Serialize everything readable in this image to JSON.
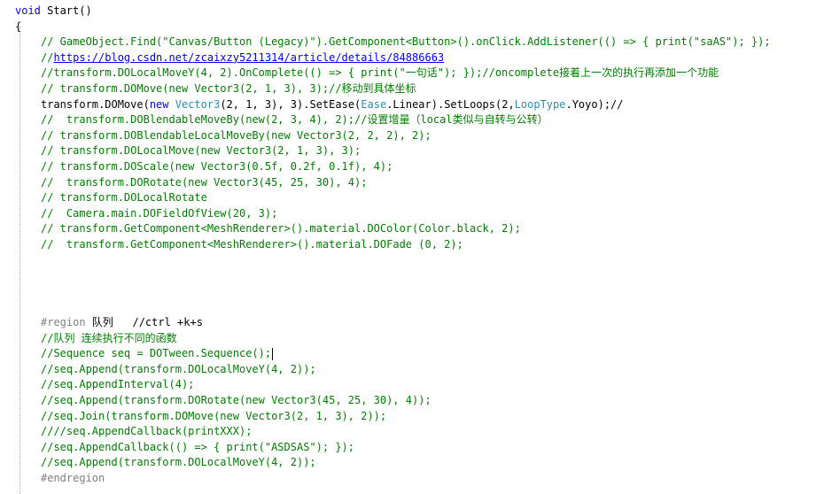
{
  "editor": {
    "lines": [
      {
        "text": "void Start()",
        "kind": "plain",
        "indent": 0
      },
      {
        "text": "{",
        "kind": "plain",
        "indent": 0
      },
      {
        "text": "// GameObject.Find(\"Canvas/Button (Legacy)\").GetComponent<Button>().onClick.AddListener(() => { print(\"saAS\"); });",
        "kind": "comment",
        "indent": 1
      },
      {
        "text": "//https://blog.csdn.net/zcaixzy5211314/article/details/84886663",
        "kind": "comment-link",
        "indent": 1
      },
      {
        "text": "//transform.DOLocalMoveY(4, 2).OnComplete(() => { print(\"一句话\"); });//oncomplete接着上一次的执行再添加一个功能",
        "kind": "comment",
        "indent": 1
      },
      {
        "text": "// transform.DOMove(new Vector3(2, 1, 3), 3);//移动到具体坐标",
        "kind": "comment",
        "indent": 1
      },
      {
        "text": "transform.DOMove(new Vector3(2, 1, 3), 3).SetEase(Ease.Linear).SetLoops(2,LoopType.Yoyo);//",
        "kind": "code",
        "indent": 1
      },
      {
        "text": "//  transform.DOBlendableMoveBy(new(2, 3, 4), 2);//设置增量（local类似与自转与公转）",
        "kind": "comment",
        "indent": 1
      },
      {
        "text": "// transform.DOBlendableLocalMoveBy(new Vector3(2, 2, 2), 2);",
        "kind": "comment",
        "indent": 1
      },
      {
        "text": "// transform.DOLocalMove(new Vector3(2, 1, 3), 3);",
        "kind": "comment",
        "indent": 1
      },
      {
        "text": "// transform.DOScale(new Vector3(0.5f, 0.2f, 0.1f), 4);",
        "kind": "comment",
        "indent": 1
      },
      {
        "text": "//  transform.DORotate(new Vector3(45, 25, 30), 4);",
        "kind": "comment",
        "indent": 1
      },
      {
        "text": "// transform.DOLocalRotate",
        "kind": "comment",
        "indent": 1
      },
      {
        "text": "//  Camera.main.DOFieldOfView(20, 3);",
        "kind": "comment",
        "indent": 1
      },
      {
        "text": "// transform.GetComponent<MeshRenderer>().material.DOColor(Color.black, 2);",
        "kind": "comment",
        "indent": 1
      },
      {
        "text": "//  transform.GetComponent<MeshRenderer>().material.DOFade (0, 2);",
        "kind": "comment",
        "indent": 1
      },
      {
        "text": "",
        "kind": "blank",
        "indent": 0
      },
      {
        "text": "",
        "kind": "blank",
        "indent": 0
      },
      {
        "text": "",
        "kind": "blank",
        "indent": 0
      },
      {
        "text": "",
        "kind": "blank",
        "indent": 0
      },
      {
        "text": "#region 队列   //ctrl +k+s",
        "kind": "region",
        "indent": 1
      },
      {
        "text": "//队列 连续执行不同的函数",
        "kind": "comment",
        "indent": 1
      },
      {
        "text": "//Sequence seq = DOTween.Sequence();",
        "kind": "comment-caret",
        "indent": 1
      },
      {
        "text": "//seq.Append(transform.DOLocalMoveY(4, 2));",
        "kind": "comment",
        "indent": 1
      },
      {
        "text": "//seq.AppendInterval(4);",
        "kind": "comment",
        "indent": 1
      },
      {
        "text": "//seq.Append(transform.DORotate(new Vector3(45, 25, 30), 4));",
        "kind": "comment",
        "indent": 1
      },
      {
        "text": "//seq.Join(transform.DOMove(new Vector3(2, 1, 3), 2));",
        "kind": "comment",
        "indent": 1
      },
      {
        "text": "////seq.AppendCallback(printXXX);",
        "kind": "comment",
        "indent": 1
      },
      {
        "text": "//seq.AppendCallback(() => { print(\"ASDSAS\"); });",
        "kind": "comment",
        "indent": 1
      },
      {
        "text": "//seq.Append(transform.DOLocalMoveY(4, 2));",
        "kind": "comment",
        "indent": 1
      },
      {
        "text": "#endregion",
        "kind": "preprocessor",
        "indent": 1
      }
    ],
    "colors": {
      "comment": "#008000",
      "keyword": "#0000ff",
      "type": "#2b91af",
      "preprocessor": "#808080",
      "link": "#0000ff",
      "text": "#000000",
      "background": "#ffffff"
    }
  }
}
